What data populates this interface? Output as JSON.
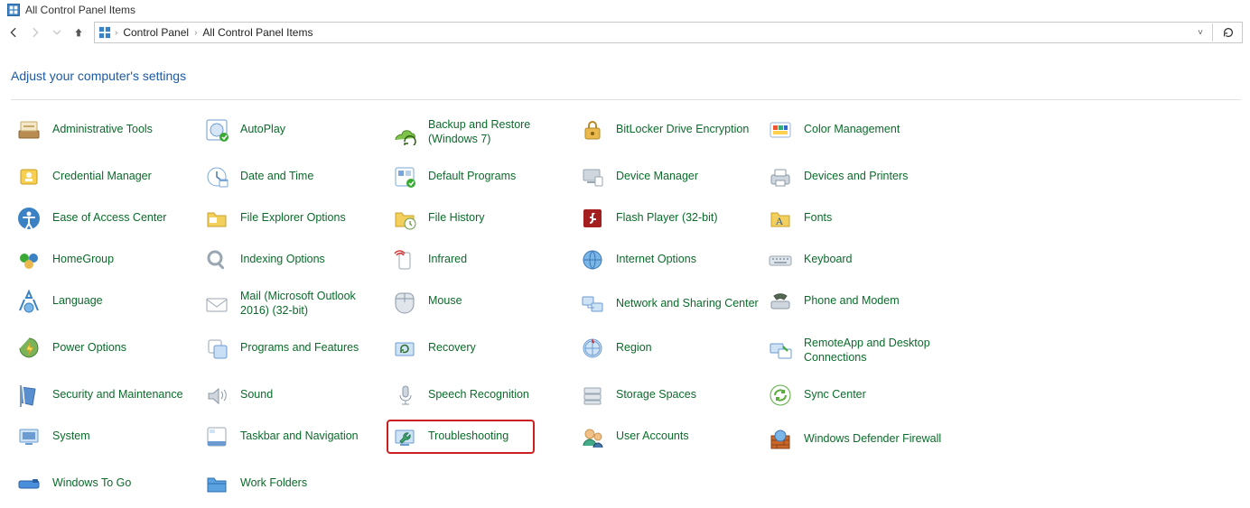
{
  "window": {
    "title": "All Control Panel Items"
  },
  "breadcrumb": {
    "root": "Control Panel",
    "current": "All Control Panel Items"
  },
  "heading": "Adjust your computer's settings",
  "items": [
    {
      "label": "Administrative Tools",
      "icon": "admin-tools",
      "highlight": false,
      "two_line": false
    },
    {
      "label": "AutoPlay",
      "icon": "autoplay",
      "highlight": false,
      "two_line": false
    },
    {
      "label": "Backup and Restore (Windows 7)",
      "icon": "backup-restore",
      "highlight": false,
      "two_line": true
    },
    {
      "label": "BitLocker Drive Encryption",
      "icon": "bitlocker",
      "highlight": false,
      "two_line": false
    },
    {
      "label": "Color Management",
      "icon": "color-mgmt",
      "highlight": false,
      "two_line": false
    },
    {
      "label": "Credential Manager",
      "icon": "credential-mgr",
      "highlight": false,
      "two_line": false
    },
    {
      "label": "Date and Time",
      "icon": "date-time",
      "highlight": false,
      "two_line": false
    },
    {
      "label": "Default Programs",
      "icon": "default-programs",
      "highlight": false,
      "two_line": false
    },
    {
      "label": "Device Manager",
      "icon": "device-mgr",
      "highlight": false,
      "two_line": false
    },
    {
      "label": "Devices and Printers",
      "icon": "devices-printers",
      "highlight": false,
      "two_line": false
    },
    {
      "label": "Ease of Access Center",
      "icon": "ease-access",
      "highlight": false,
      "two_line": false
    },
    {
      "label": "File Explorer Options",
      "icon": "file-explorer-opts",
      "highlight": false,
      "two_line": false
    },
    {
      "label": "File History",
      "icon": "file-history",
      "highlight": false,
      "two_line": false
    },
    {
      "label": "Flash Player (32-bit)",
      "icon": "flash-player",
      "highlight": false,
      "two_line": false
    },
    {
      "label": "Fonts",
      "icon": "fonts",
      "highlight": false,
      "two_line": false
    },
    {
      "label": "HomeGroup",
      "icon": "homegroup",
      "highlight": false,
      "two_line": false
    },
    {
      "label": "Indexing Options",
      "icon": "indexing",
      "highlight": false,
      "two_line": false
    },
    {
      "label": "Infrared",
      "icon": "infrared",
      "highlight": false,
      "two_line": false
    },
    {
      "label": "Internet Options",
      "icon": "internet-options",
      "highlight": false,
      "two_line": false
    },
    {
      "label": "Keyboard",
      "icon": "keyboard",
      "highlight": false,
      "two_line": false
    },
    {
      "label": "Language",
      "icon": "language",
      "highlight": false,
      "two_line": false
    },
    {
      "label": "Mail (Microsoft Outlook 2016) (32-bit)",
      "icon": "mail",
      "highlight": false,
      "two_line": true
    },
    {
      "label": "Mouse",
      "icon": "mouse",
      "highlight": false,
      "two_line": false
    },
    {
      "label": "Network and Sharing Center",
      "icon": "network-sharing",
      "highlight": false,
      "two_line": true
    },
    {
      "label": "Phone and Modem",
      "icon": "phone-modem",
      "highlight": false,
      "two_line": false
    },
    {
      "label": "Power Options",
      "icon": "power",
      "highlight": false,
      "two_line": false
    },
    {
      "label": "Programs and Features",
      "icon": "programs-features",
      "highlight": false,
      "two_line": false
    },
    {
      "label": "Recovery",
      "icon": "recovery",
      "highlight": false,
      "two_line": false
    },
    {
      "label": "Region",
      "icon": "region",
      "highlight": false,
      "two_line": false
    },
    {
      "label": "RemoteApp and Desktop Connections",
      "icon": "remoteapp",
      "highlight": false,
      "two_line": true
    },
    {
      "label": "Security and Maintenance",
      "icon": "security-maint",
      "highlight": false,
      "two_line": false
    },
    {
      "label": "Sound",
      "icon": "sound",
      "highlight": false,
      "two_line": false
    },
    {
      "label": "Speech Recognition",
      "icon": "speech",
      "highlight": false,
      "two_line": false
    },
    {
      "label": "Storage Spaces",
      "icon": "storage",
      "highlight": false,
      "two_line": false
    },
    {
      "label": "Sync Center",
      "icon": "sync",
      "highlight": false,
      "two_line": false
    },
    {
      "label": "System",
      "icon": "system",
      "highlight": false,
      "two_line": false
    },
    {
      "label": "Taskbar and Navigation",
      "icon": "taskbar",
      "highlight": false,
      "two_line": false
    },
    {
      "label": "Troubleshooting",
      "icon": "troubleshooting",
      "highlight": true,
      "two_line": false
    },
    {
      "label": "User Accounts",
      "icon": "user-accounts",
      "highlight": false,
      "two_line": false
    },
    {
      "label": "Windows Defender Firewall",
      "icon": "firewall",
      "highlight": false,
      "two_line": true
    },
    {
      "label": "Windows To Go",
      "icon": "windows-to-go",
      "highlight": false,
      "two_line": false
    },
    {
      "label": "Work Folders",
      "icon": "work-folders",
      "highlight": false,
      "two_line": false
    }
  ]
}
